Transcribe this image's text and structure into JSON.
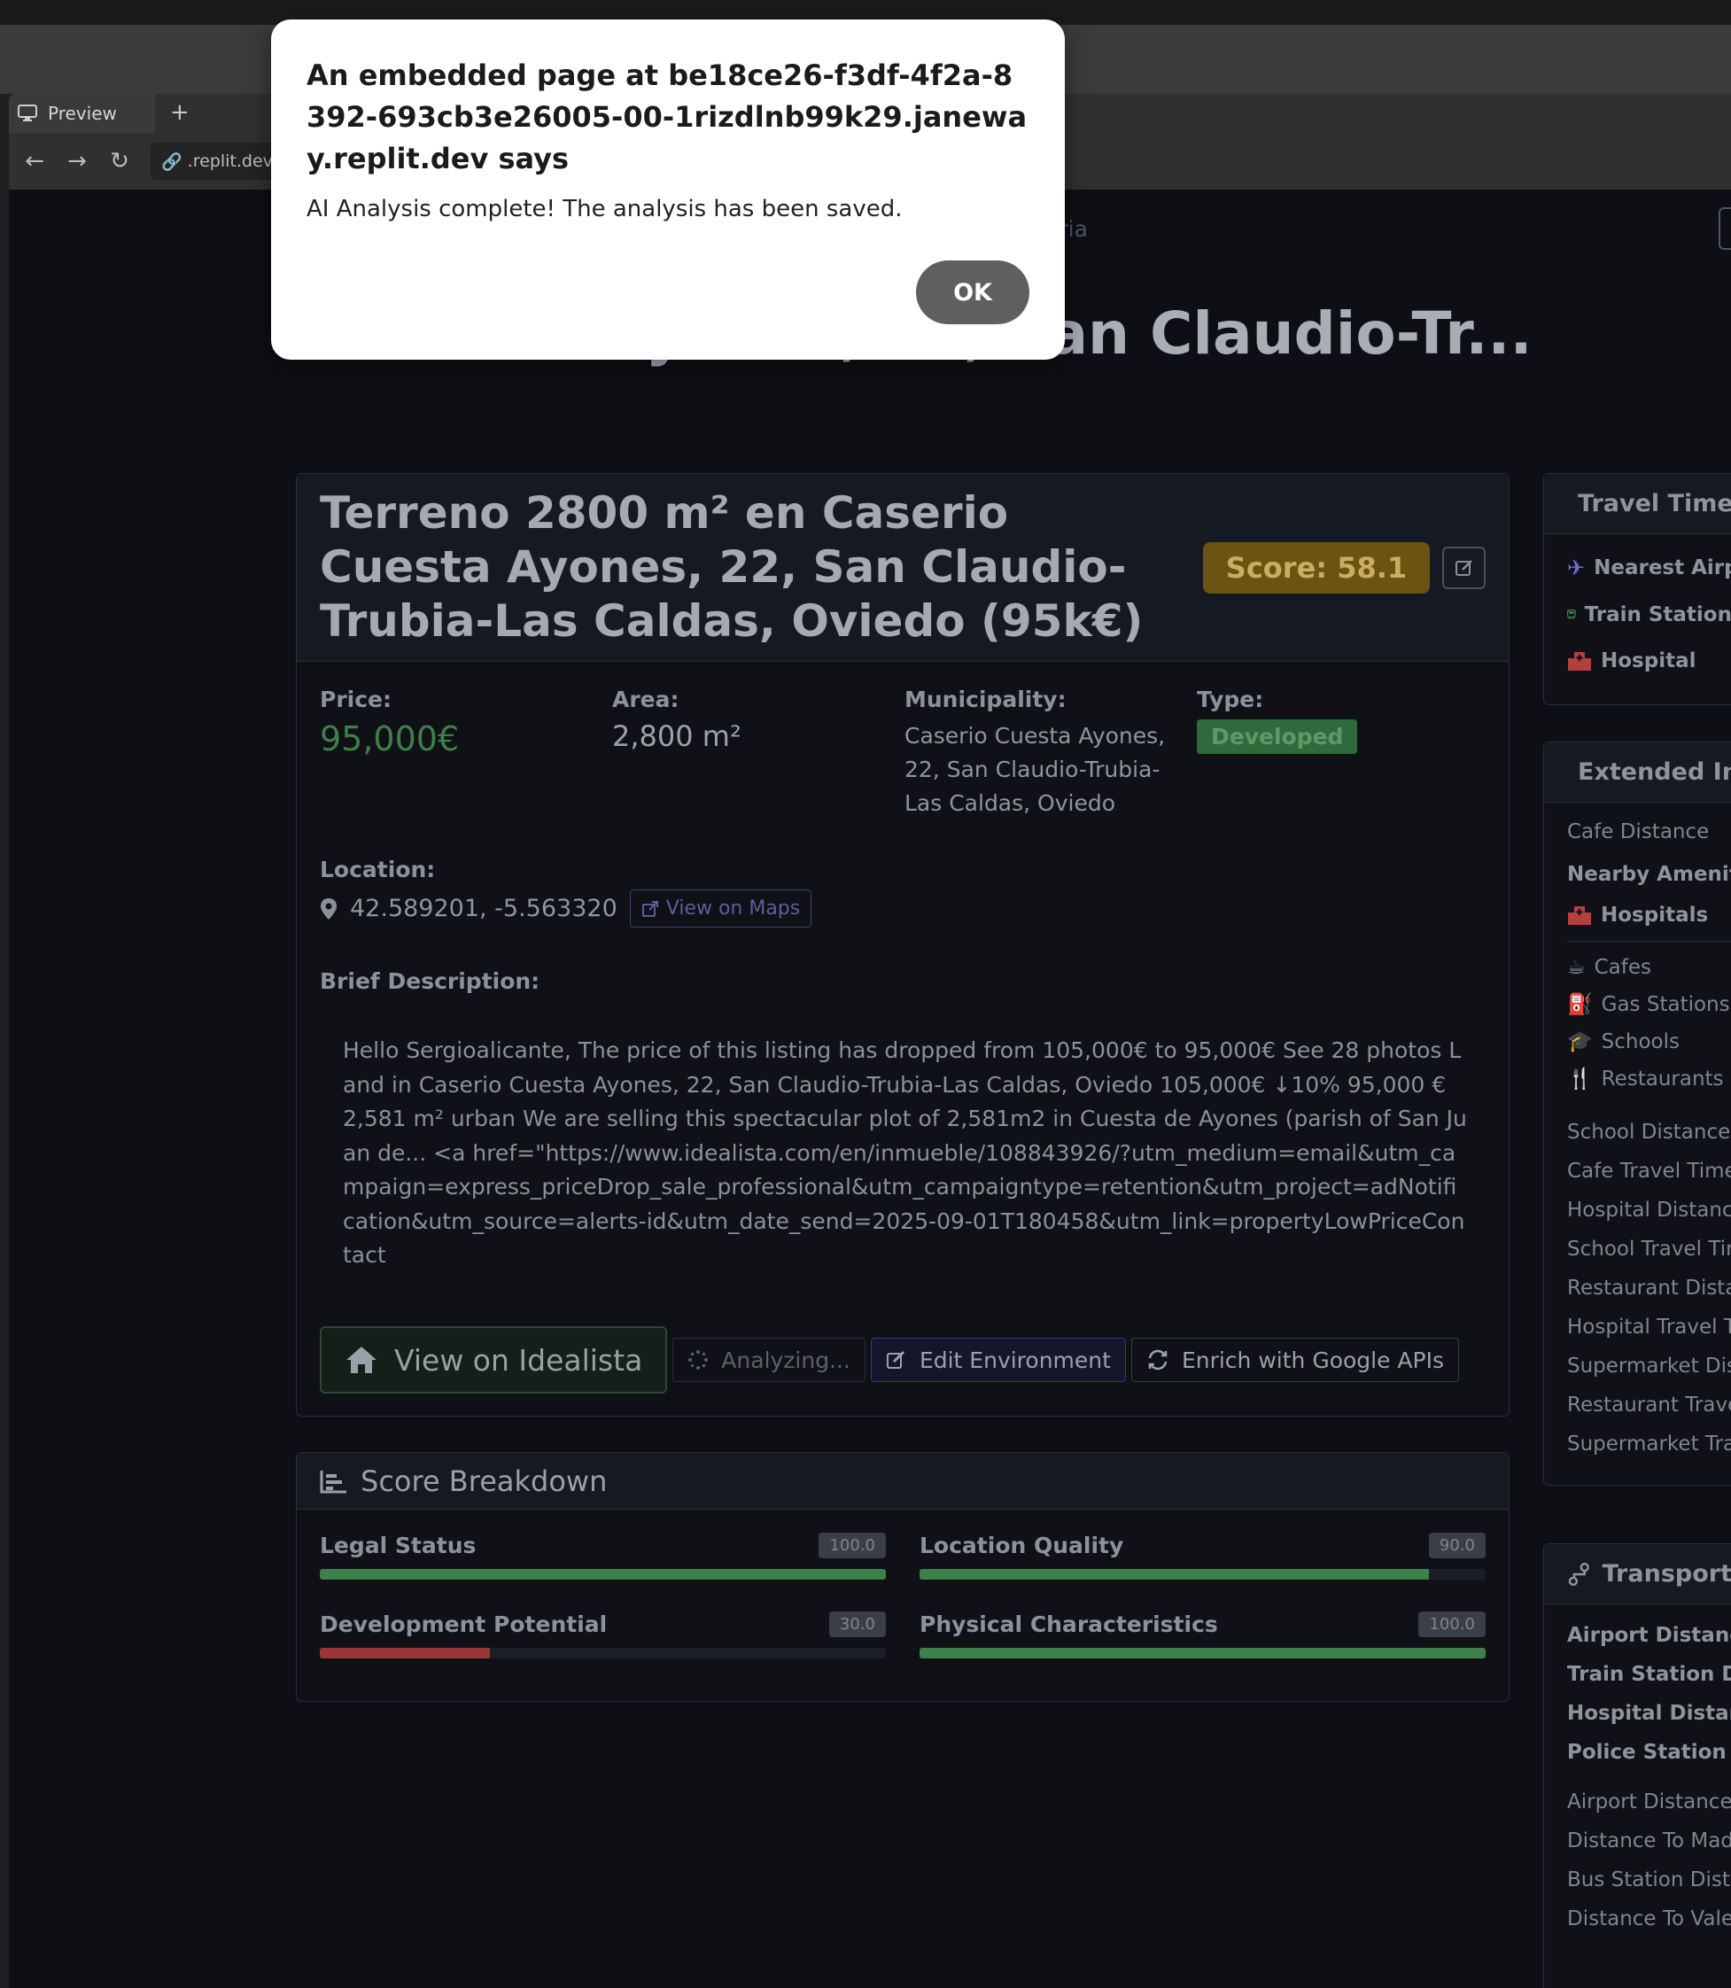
{
  "browser": {
    "tab_label": "Preview",
    "new_tab": "+",
    "url": ".replit.dev/lan"
  },
  "page": {
    "breadcrumb_tail": "eria",
    "title": "o Cuesta Ayones, 22, San Claudio-Tr..."
  },
  "listing": {
    "title": "Terreno 2800 m² en Caserio Cuesta Ayones, 22, San Claudio-Trubia-Las Caldas, Oviedo (95k€)",
    "score": "Score: 58.1",
    "price_label": "Price:",
    "price": "95,000€",
    "area_label": "Area:",
    "area": "2,800 m²",
    "municipality_label": "Municipality:",
    "municipality": "Caserio Cuesta Ayones, 22, San Claudio-Trubia-Las Caldas, Oviedo",
    "type_label": "Type:",
    "type": "Developed",
    "location_label": "Location:",
    "coordinates": "42.589201, -5.563320",
    "view_on_maps": "View on Maps",
    "description_label": "Brief Description:",
    "description": "Hello Sergioalicante, The price of this listing has dropped from 105,000€ to 95,000€ See 28 photos Land in Caserio Cuesta Ayones, 22, San Claudio-Trubia-Las Caldas, Oviedo 105,000€ ↓10% 95,000 € 2,581 m² urban We are selling this spectacular plot of 2,581m2 in Cuesta de Ayones (parish of San Juan de... <a href=\"https://www.idealista.com/en/inmueble/108843926/?utm_medium=email&utm_campaign=express_priceDrop_sale_professional&utm_campaigntype=retention&utm_project=adNotification&utm_source=alerts-id&utm_date_send=2025-09-01T180458&utm_link=propertyLowPriceContact"
  },
  "actions": {
    "view_idealista": "View on Idealista",
    "analyzing": "Analyzing...",
    "edit_environment": "Edit Environment",
    "enrich": "Enrich with Google APIs"
  },
  "score_breakdown": {
    "title": "Score Breakdown",
    "items": [
      {
        "name": "Legal Status",
        "value": "100.0",
        "pct": 100,
        "color": "#3f7f4a"
      },
      {
        "name": "Location Quality",
        "value": "90.0",
        "pct": 90,
        "color": "#3f7f4a"
      },
      {
        "name": "Development Potential",
        "value": "30.0",
        "pct": 30,
        "color": "#9c3535"
      },
      {
        "name": "Physical Characteristics",
        "value": "100.0",
        "pct": 100,
        "color": "#3f7f4a"
      }
    ]
  },
  "travel_times": {
    "title": "Travel Times",
    "items": [
      "Nearest Airpor",
      "Train Station",
      "Hospital"
    ]
  },
  "extended_info": {
    "title": "Extended Inf",
    "cafe_distance": "Cafe Distance",
    "nearby_amenities": "Nearby Amenities",
    "hospitals": "Hospitals",
    "amenities": [
      "Cafes",
      "Gas Stations",
      "Schools",
      "Restaurants"
    ],
    "fields": [
      "School Distance",
      "Cafe Travel Time",
      "Hospital Distance",
      "School Travel Time",
      "Restaurant Distanc",
      "Hospital Travel Tin",
      "Supermarket Dista",
      "Restaurant Travel",
      "Supermarket Trave"
    ]
  },
  "transport": {
    "title": "Transport",
    "bold_items": [
      "Airport Distance",
      "Train Station Dist",
      "Hospital Distance",
      "Police Station Dis"
    ],
    "items": [
      "Airport Distance",
      "Distance To Madrid",
      "Bus Station Distan",
      "Distance To Valenc"
    ]
  },
  "dialog": {
    "title": "An embedded page at be18ce26-f3df-4f2a-8392-693cb3e26005-00-1rizdlnb99k29.janeway.replit.dev says",
    "message": "AI Analysis complete! The analysis has been saved.",
    "ok": "OK"
  },
  "colors": {
    "accent_green": "#3f7f4a",
    "score_badge": "#6b5410",
    "danger": "#9c3535"
  }
}
